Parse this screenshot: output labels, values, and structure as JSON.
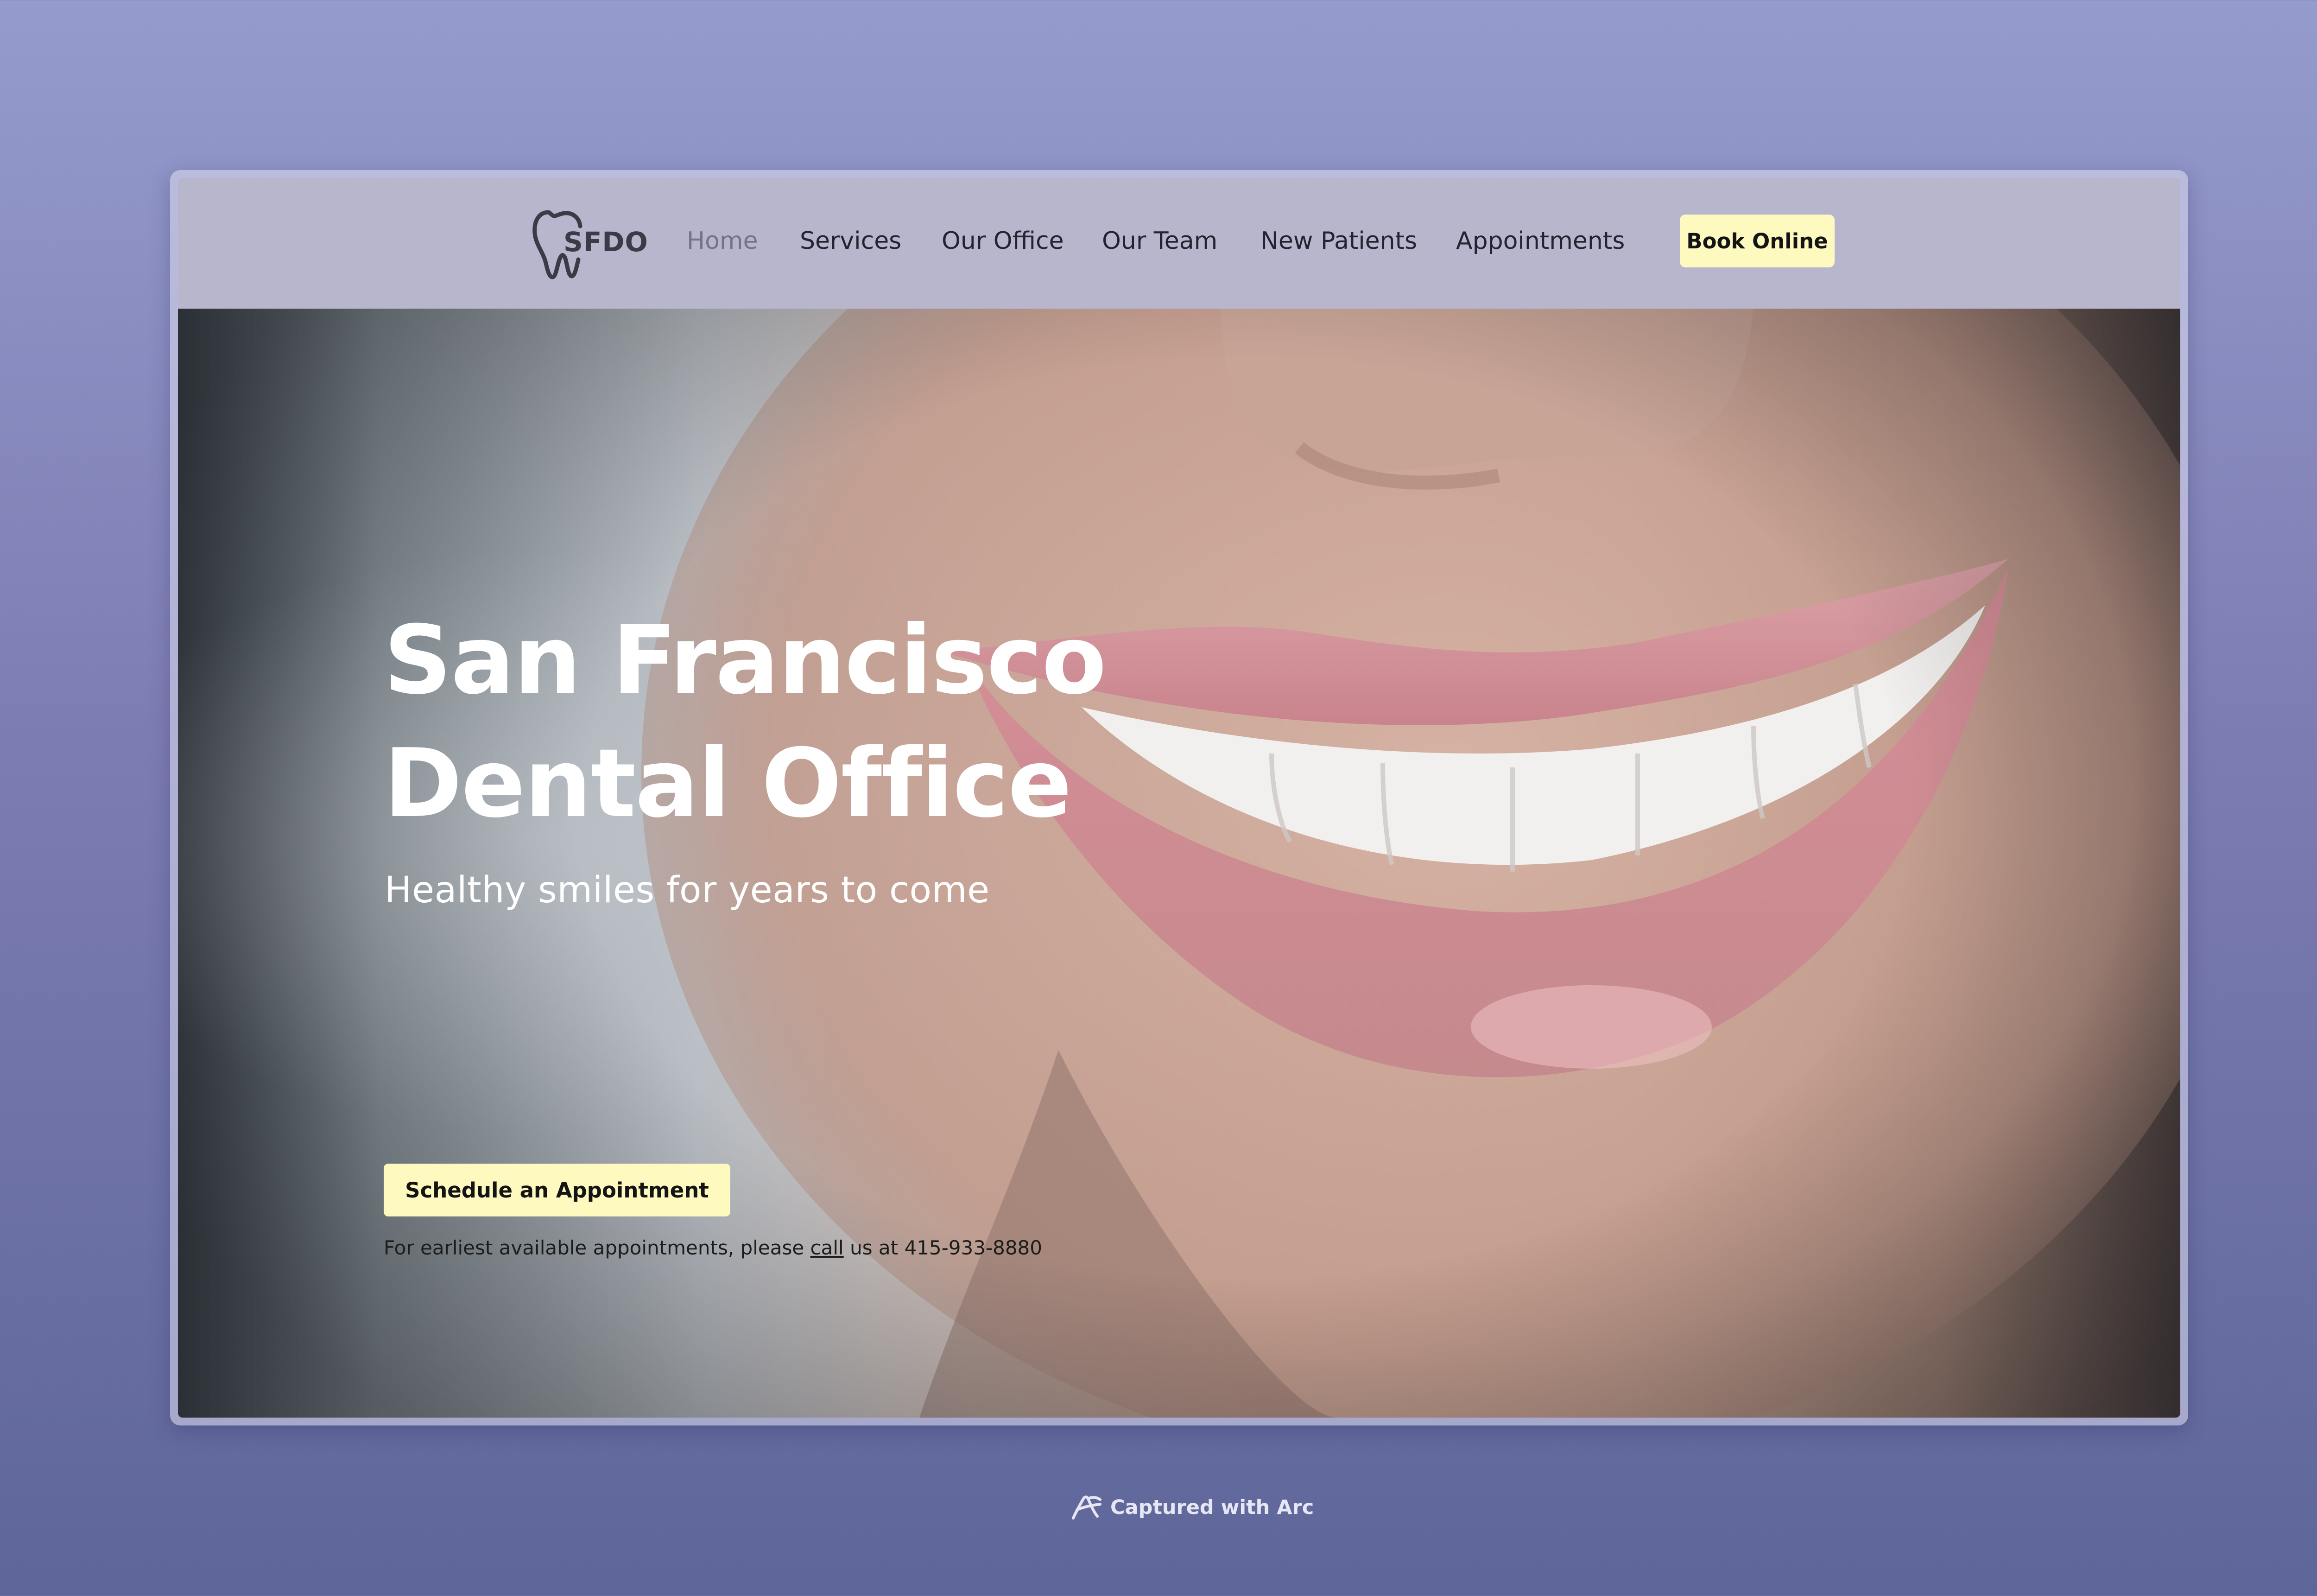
{
  "site": {
    "logo_text": "SFDO"
  },
  "nav": {
    "items": [
      {
        "label": "Home",
        "active": true
      },
      {
        "label": "Services",
        "active": false
      },
      {
        "label": "Our Office",
        "active": false
      },
      {
        "label": "Our Team",
        "active": false
      },
      {
        "label": "New Patients",
        "active": false
      },
      {
        "label": "Appointments",
        "active": false
      }
    ],
    "cta_label": "Book Online"
  },
  "hero": {
    "title_line1": "San Francisco",
    "title_line2": "Dental Office",
    "subtitle": "Healthy smiles for years to come",
    "button_label": "Schedule an Appointment",
    "note_prefix": "For earliest available appointments, please ",
    "note_link": "call",
    "note_suffix": " us at 415-933-8880"
  },
  "footer": {
    "capture_text": "Captured with Arc"
  },
  "colors": {
    "header_bg": "#b8b6cd",
    "cta_bg": "#fdf9bf",
    "nav_active": "#757389",
    "nav_text": "#242332"
  },
  "icons": {
    "logo": "tooth-icon",
    "capture": "arc-icon"
  }
}
